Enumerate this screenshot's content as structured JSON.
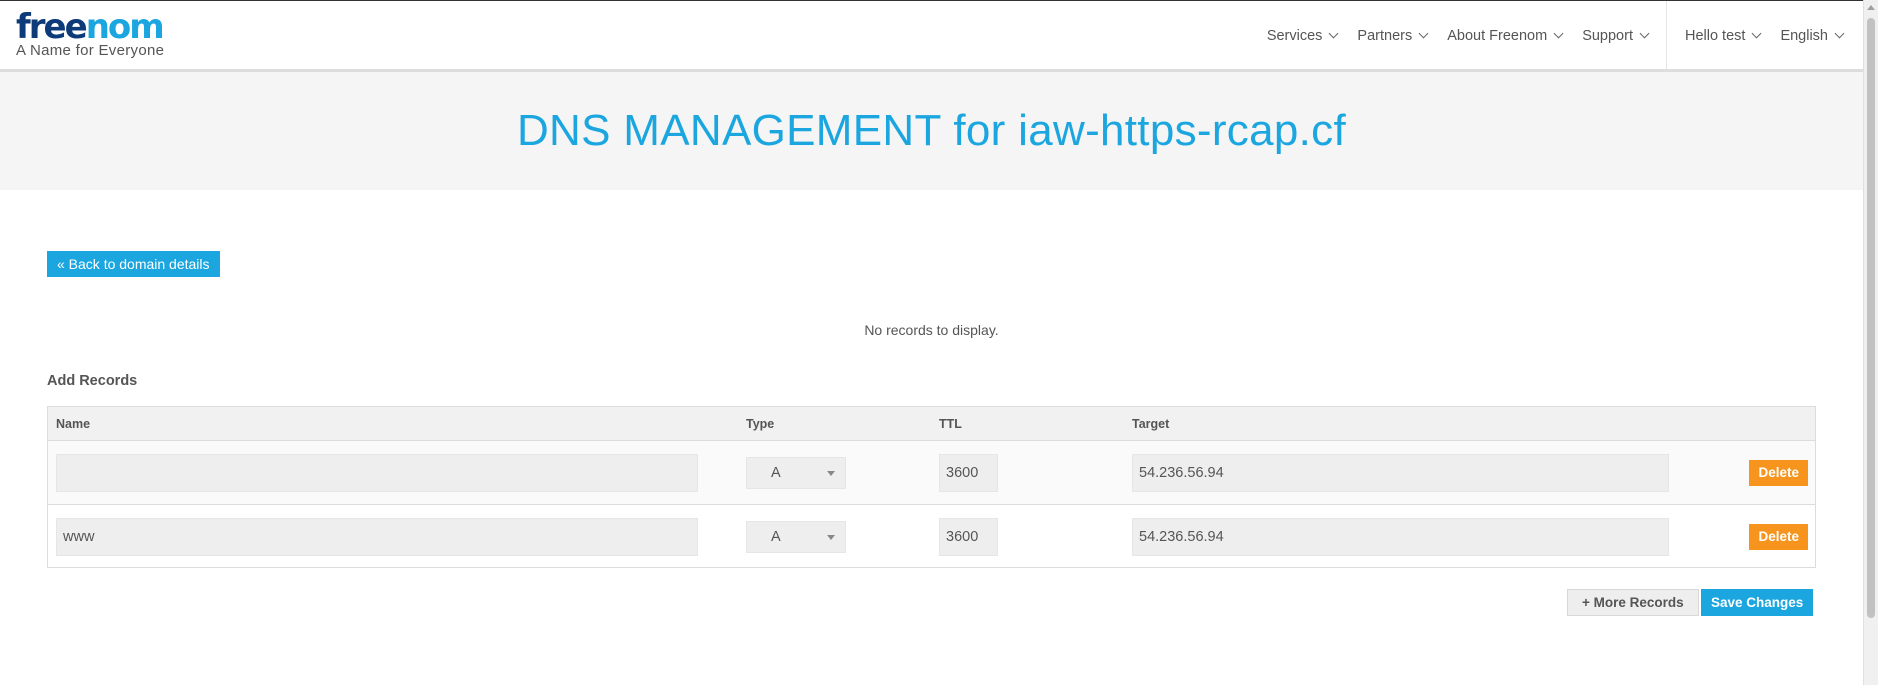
{
  "brand": {
    "name_part1": "free",
    "name_part2": "nom",
    "tagline": "A Name for Everyone"
  },
  "nav": {
    "items": [
      {
        "label": "Services"
      },
      {
        "label": "Partners"
      },
      {
        "label": "About Freenom"
      },
      {
        "label": "Support"
      }
    ],
    "user": "Hello test",
    "language": "English"
  },
  "page": {
    "title": "DNS MANAGEMENT for iaw-https-rcap.cf",
    "back_label": "« Back to domain details",
    "empty_message": "No records to display.",
    "add_heading": "Add Records"
  },
  "records_table": {
    "columns": {
      "name": "Name",
      "type": "Type",
      "ttl": "TTL",
      "target": "Target"
    },
    "rows": [
      {
        "name": "",
        "type": "A",
        "ttl": "3600",
        "target": "54.236.56.94",
        "delete_label": "Delete"
      },
      {
        "name": "www",
        "type": "A",
        "ttl": "3600",
        "target": "54.236.56.94",
        "delete_label": "Delete"
      }
    ]
  },
  "actions": {
    "more_label": "More Records",
    "more_icon": "+",
    "save_label": "Save Changes"
  },
  "colors": {
    "brand_blue": "#1ba6e0",
    "brand_navy": "#0d3a78",
    "delete_orange": "#f7941d"
  }
}
